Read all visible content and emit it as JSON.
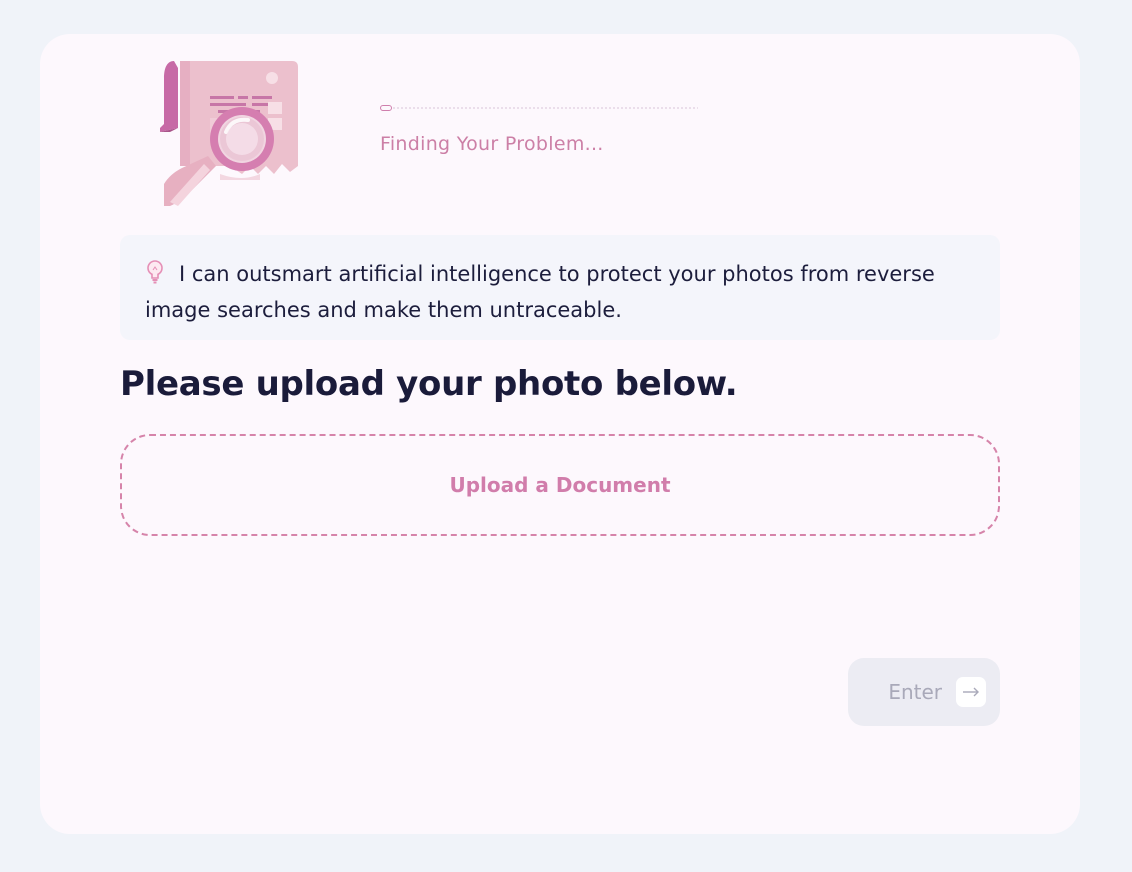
{
  "progress": {
    "value": 0.03,
    "status_text": "Finding Your Problem..."
  },
  "tip": {
    "text": "I can outsmart artificial intelligence to protect your photos from reverse image searches and make them untraceable.",
    "icon": "lightbulb-icon"
  },
  "main": {
    "heading": "Please upload your photo below.",
    "upload_label": "Upload a Document"
  },
  "actions": {
    "enter_label": "Enter",
    "enter_icon": "arrow-right-icon"
  },
  "colors": {
    "accent": "#d17dab",
    "page_background": "#f0f3f9",
    "card_background": "#fdf8fd",
    "text_dark": "#1a1b3a",
    "button_disabled": "#ececf3"
  }
}
